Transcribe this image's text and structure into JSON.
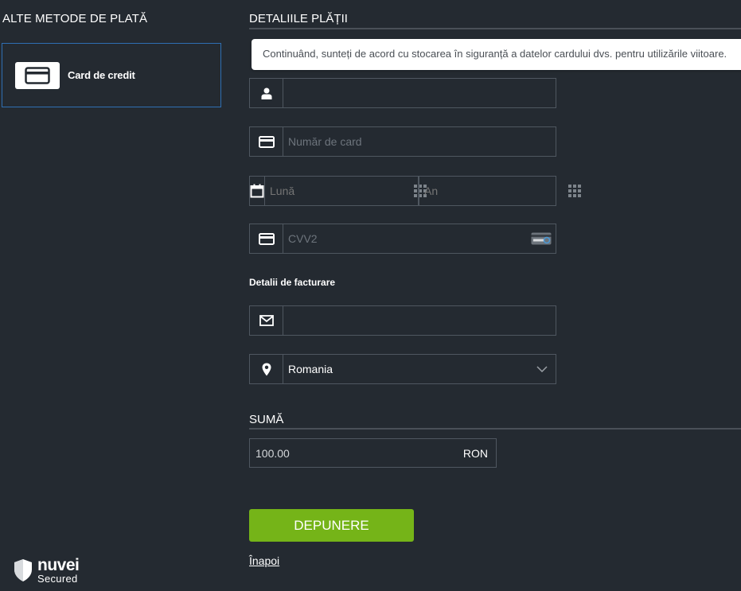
{
  "left": {
    "title": "ALTE METODE DE PLATĂ",
    "methods": [
      {
        "label": "Card de credit",
        "icon": "credit-card-icon"
      }
    ]
  },
  "payment": {
    "title": "DETALIILE PLĂȚII",
    "tooltip": "Continuând, sunteți de acord cu stocarea în siguranță a datelor cardului dvs. pentru utilizările viitoare.",
    "name_value": "",
    "card_placeholder": "Număr de card",
    "month_placeholder": "Lună",
    "year_placeholder": "An",
    "cvv_placeholder": "CVV2"
  },
  "billing": {
    "title": "Detalii de facturare",
    "email_value": "",
    "country": "Romania"
  },
  "amount": {
    "title": "SUMĂ",
    "value": "100.00",
    "currency": "RON"
  },
  "actions": {
    "submit_label": "DEPUNERE",
    "back_label": "Înapoi"
  },
  "brand": {
    "name": "nuvei",
    "sub": "Secured"
  },
  "colors": {
    "background": "#242a31",
    "accent_green": "#75b418",
    "selected_border": "#2f6fb3",
    "field_border": "#4f5760"
  }
}
